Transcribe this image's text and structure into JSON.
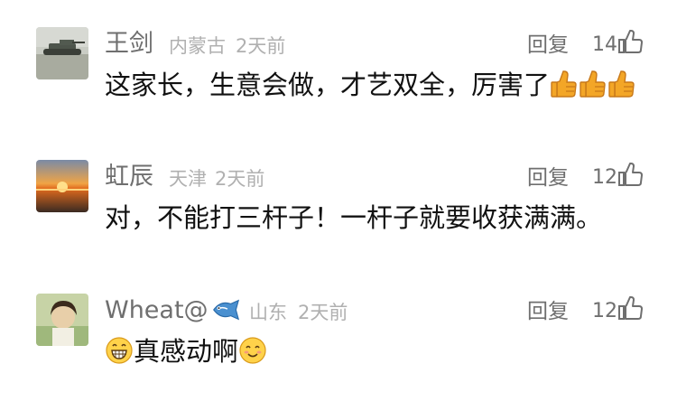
{
  "comments": [
    {
      "username": "王剑",
      "location": "内蒙古",
      "time": "2天前",
      "reply_label": "回复",
      "likes": "14",
      "text": "这家长，生意会做，才艺双全，厉害了",
      "emojis": [
        "thumbs-up-emoji",
        "thumbs-up-emoji",
        "thumbs-up-emoji"
      ]
    },
    {
      "username": "虹辰",
      "location": "天津",
      "time": "2天前",
      "reply_label": "回复",
      "likes": "12",
      "text": "对，不能打三杆子！一杆子就要收获满满。"
    },
    {
      "username": "Wheat@",
      "username_icon": "fish-emoji",
      "location": "山东",
      "time": "2天前",
      "reply_label": "回复",
      "likes": "12",
      "text": "真感动啊",
      "leading_emoji": "grinning-emoji",
      "trailing_emoji": "smiling-emoji"
    }
  ],
  "colors": {
    "username": "#6f6f6f",
    "meta": "#b0b0b0",
    "text": "#111111",
    "thumb_emoji": "#f3a627"
  }
}
